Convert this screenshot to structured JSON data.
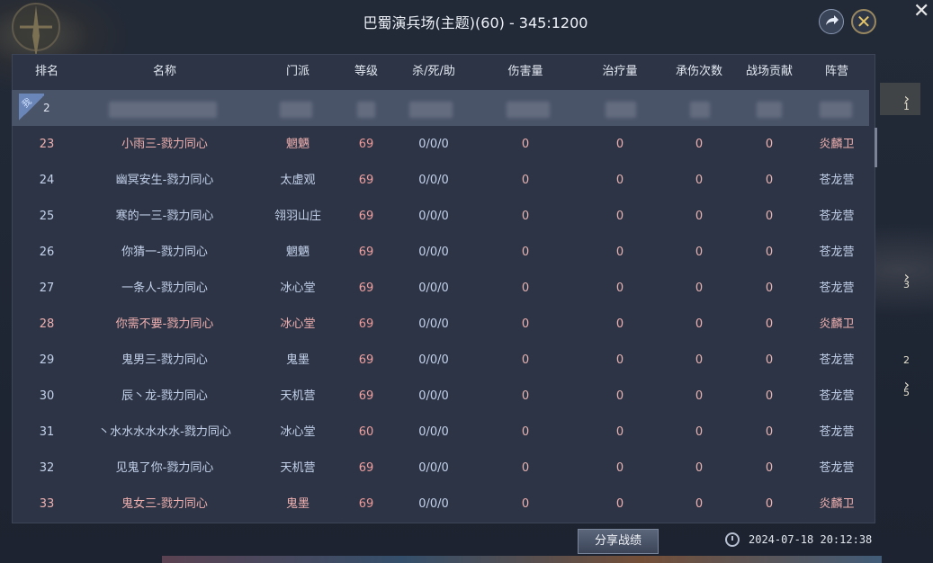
{
  "title": "巴蜀演兵场(主题)(60) - 345:1200",
  "headers": [
    "排名",
    "名称",
    "门派",
    "等级",
    "杀/死/助",
    "伤害量",
    "治疗量",
    "承伤次数",
    "战场贡献",
    "阵营"
  ],
  "mine": {
    "badge": "我",
    "rank": "2"
  },
  "rows": [
    {
      "rank": "23",
      "name": "小雨三-戮力同心",
      "school": "魍魉",
      "level": "69",
      "kda": "0/0/0",
      "dmg": "0",
      "heal": "0",
      "taken": "0",
      "contrib": "0",
      "camp": "炎麟卫",
      "side": "red"
    },
    {
      "rank": "24",
      "name": "幽冥安生-戮力同心",
      "school": "太虚观",
      "level": "69",
      "kda": "0/0/0",
      "dmg": "0",
      "heal": "0",
      "taken": "0",
      "contrib": "0",
      "camp": "苍龙营",
      "side": "blue"
    },
    {
      "rank": "25",
      "name": "寒的一三-戮力同心",
      "school": "翎羽山庄",
      "level": "69",
      "kda": "0/0/0",
      "dmg": "0",
      "heal": "0",
      "taken": "0",
      "contrib": "0",
      "camp": "苍龙营",
      "side": "blue"
    },
    {
      "rank": "26",
      "name": "你猜一-戮力同心",
      "school": "魍魉",
      "level": "69",
      "kda": "0/0/0",
      "dmg": "0",
      "heal": "0",
      "taken": "0",
      "contrib": "0",
      "camp": "苍龙营",
      "side": "blue"
    },
    {
      "rank": "27",
      "name": "一条人-戮力同心",
      "school": "冰心堂",
      "level": "69",
      "kda": "0/0/0",
      "dmg": "0",
      "heal": "0",
      "taken": "0",
      "contrib": "0",
      "camp": "苍龙营",
      "side": "blue"
    },
    {
      "rank": "28",
      "name": "你需不要-戮力同心",
      "school": "冰心堂",
      "level": "69",
      "kda": "0/0/0",
      "dmg": "0",
      "heal": "0",
      "taken": "0",
      "contrib": "0",
      "camp": "炎麟卫",
      "side": "red"
    },
    {
      "rank": "29",
      "name": "鬼男三-戮力同心",
      "school": "鬼墨",
      "level": "69",
      "kda": "0/0/0",
      "dmg": "0",
      "heal": "0",
      "taken": "0",
      "contrib": "0",
      "camp": "苍龙营",
      "side": "blue"
    },
    {
      "rank": "30",
      "name": "辰丶龙-戮力同心",
      "school": "天机营",
      "level": "69",
      "kda": "0/0/0",
      "dmg": "0",
      "heal": "0",
      "taken": "0",
      "contrib": "0",
      "camp": "苍龙营",
      "side": "blue"
    },
    {
      "rank": "31",
      "name": "丶水水水水水水-戮力同心",
      "school": "冰心堂",
      "level": "60",
      "kda": "0/0/0",
      "dmg": "0",
      "heal": "0",
      "taken": "0",
      "contrib": "0",
      "camp": "苍龙营",
      "side": "blue"
    },
    {
      "rank": "32",
      "name": "见鬼了你-戮力同心",
      "school": "天机营",
      "level": "69",
      "kda": "0/0/0",
      "dmg": "0",
      "heal": "0",
      "taken": "0",
      "contrib": "0",
      "camp": "苍龙营",
      "side": "blue"
    },
    {
      "rank": "33",
      "name": "鬼女三-戮力同心",
      "school": "鬼墨",
      "level": "69",
      "kda": "0/0/0",
      "dmg": "0",
      "heal": "0",
      "taken": "0",
      "contrib": "0",
      "camp": "炎麟卫",
      "side": "red"
    }
  ],
  "share_label": "分享战绩",
  "timestamp": "2024-07-18 20:12:38",
  "side_tabs": [
    "1",
    "3",
    "2",
    "5"
  ],
  "colors": {
    "red_camp": "#f0b0b0",
    "blue_camp": "#c4d2ec",
    "accent": "#e6c56a"
  }
}
